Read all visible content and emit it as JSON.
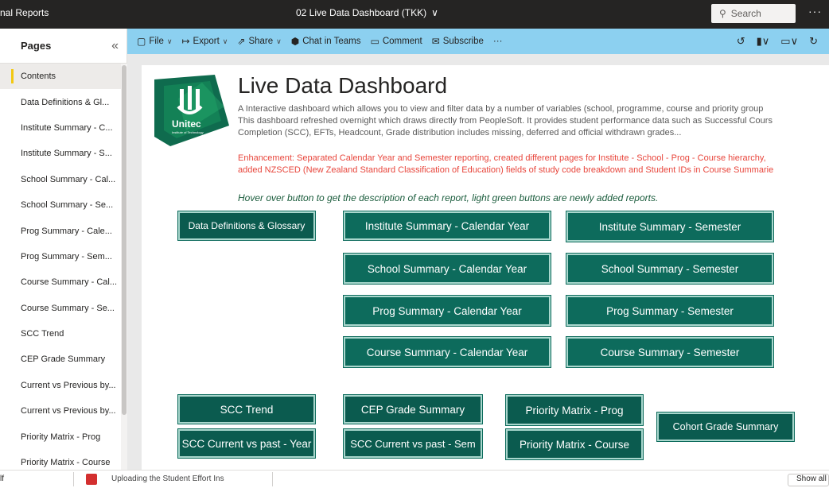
{
  "titlebar": {
    "app_name": "nal Reports",
    "report_title": "02 Live Data Dashboard (TKK)",
    "search_placeholder": "Search",
    "more": "···"
  },
  "pages_pane": {
    "title": "Pages",
    "items": [
      {
        "label": "Contents",
        "active": true
      },
      {
        "label": "Data Definitions & Gl..."
      },
      {
        "label": "Institute Summary - C..."
      },
      {
        "label": "Institute Summary - S..."
      },
      {
        "label": "School Summary - Cal..."
      },
      {
        "label": "School Summary - Se..."
      },
      {
        "label": "Prog Summary - Cale..."
      },
      {
        "label": "Prog Summary - Sem..."
      },
      {
        "label": "Course Summary - Cal..."
      },
      {
        "label": "Course Summary - Se..."
      },
      {
        "label": "SCC Trend"
      },
      {
        "label": "CEP Grade Summary"
      },
      {
        "label": "Current vs Previous by..."
      },
      {
        "label": "Current vs Previous by..."
      },
      {
        "label": "Priority Matrix - Prog"
      },
      {
        "label": "Priority Matrix - Course"
      }
    ]
  },
  "ribbon": {
    "file": "File",
    "export": "Export",
    "share": "Share",
    "chat_in_teams": "Chat in Teams",
    "comment": "Comment",
    "subscribe": "Subscribe",
    "more": "···"
  },
  "report": {
    "title": "Live Data Dashboard",
    "logo_text": "Unitec",
    "logo_subtext": "Institute of Technology",
    "description_lines": [
      "A Interactive dashboard which allows you to view and filter data by a number of variables (school, programme, course and priority group",
      "This dashboard refreshed overnight which draws directly from PeopleSoft. It provides student performance data such as Successful Cours",
      "Completion (SCC), EFTs, Headcount, Grade distribution includes missing, deferred and official withdrawn grades..."
    ],
    "enhancement_lines": [
      "Enhancement: Separated Calendar Year and Semester reporting, created different pages for Institute - School - Prog - Course hierarchy,",
      "added NZSCED (New Zealand Standard Classification of Education) fields of study code breakdown and Student IDs in Course Summarie"
    ],
    "hover_note": "Hover over button to get the description of each report, light green buttons are newly added reports.",
    "buttons": {
      "data_definitions": "Data Definitions & Glossary",
      "institute_calendar": "Institute Summary - Calendar Year",
      "institute_semester": "Institute Summary - Semester",
      "school_calendar": "School Summary - Calendar Year",
      "school_semester": "School Summary - Semester",
      "prog_calendar": "Prog Summary - Calendar Year",
      "prog_semester": "Prog Summary - Semester",
      "course_calendar": "Course Summary - Calendar Year",
      "course_semester": "Course Summary - Semester",
      "scc_trend": "SCC Trend",
      "cep_grade": "CEP Grade Summary",
      "priority_prog": "Priority Matrix - Prog",
      "cohort_grade": "Cohort Grade Summary",
      "scc_year": "SCC Current vs past - Year",
      "scc_sem": "SCC Current vs past - Sem",
      "priority_course": "Priority Matrix - Course"
    }
  },
  "downloads": {
    "file1": "lf",
    "file2": "Uploading the Student Effort Ins",
    "show_all": "Show all"
  },
  "colors": {
    "ribbon": "#8cd0f0",
    "button_bg": "#0d6b5c",
    "enhancement_text": "#e8463c",
    "active_page_marker": "#f2c811"
  }
}
